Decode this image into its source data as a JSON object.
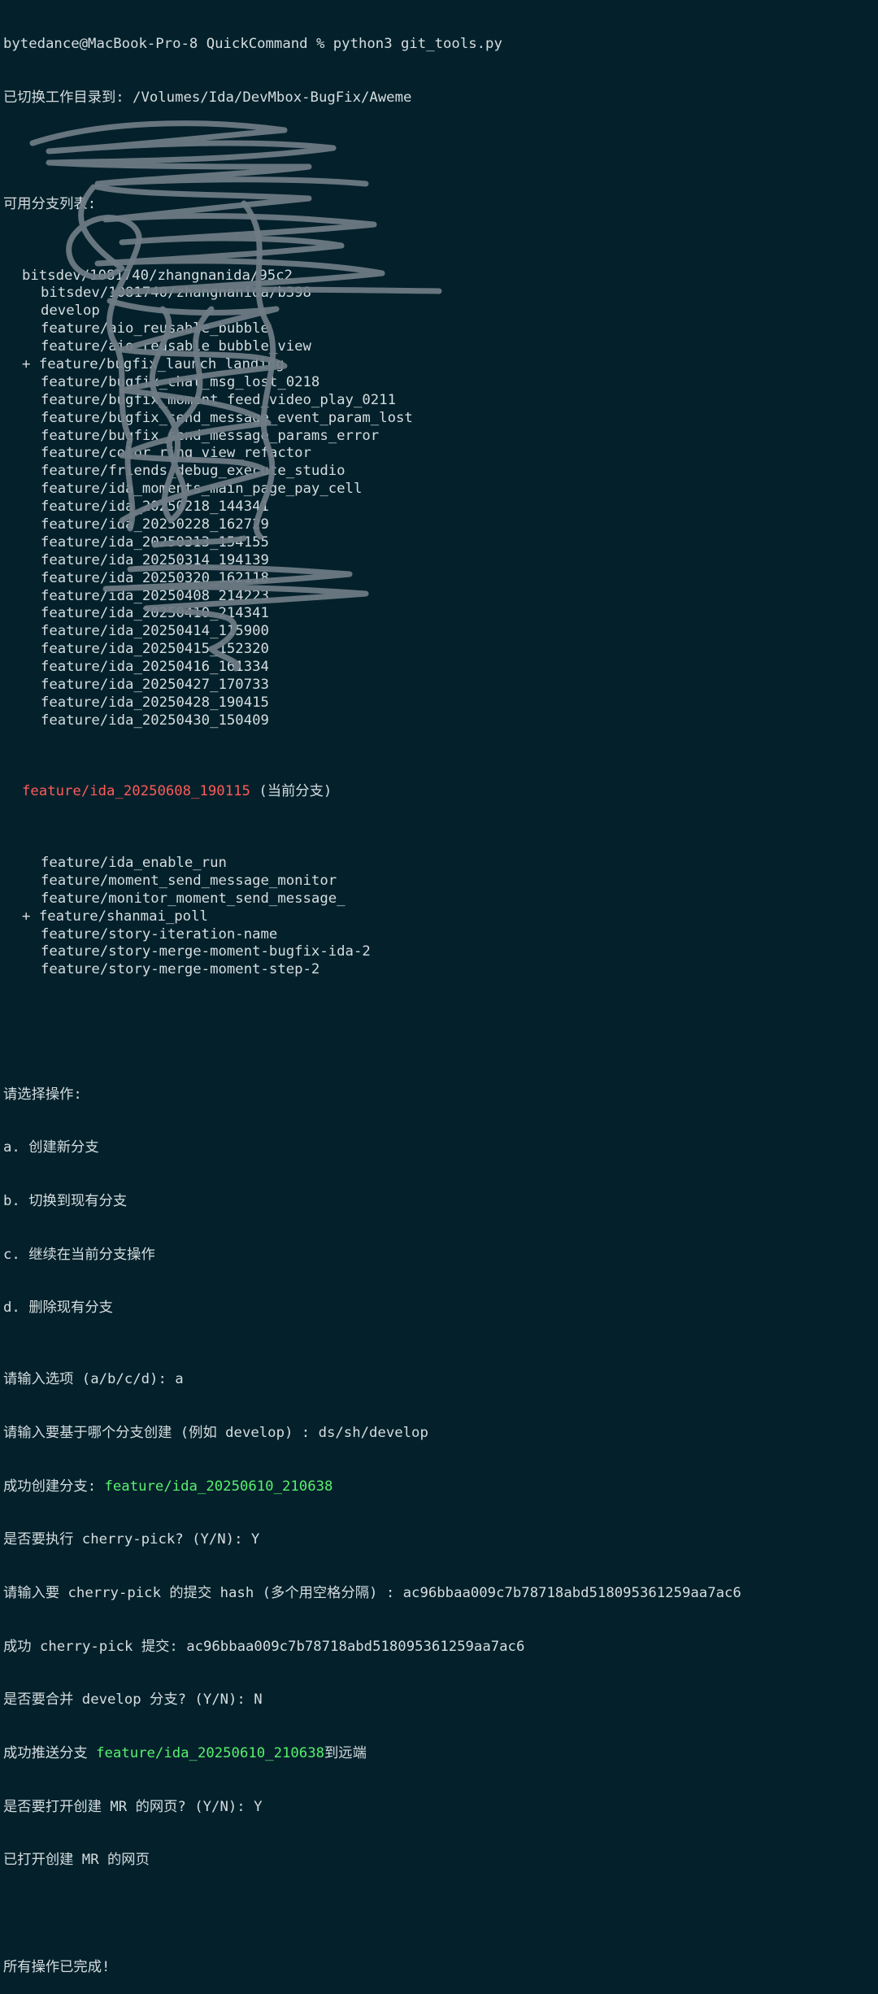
{
  "prompt": "bytedance@MacBook-Pro-8 QuickCommand % python3 git_tools.py",
  "cwd_line": "已切换工作目录到: /Volumes/Ida/DevMbox-BugFix/Aweme",
  "branch_list_title": "可用分支列表:",
  "branches": [
    {
      "prefix": "",
      "name": "bitsdev/1081740/zhangnanida/95c2",
      "indent": 1
    },
    {
      "prefix": "",
      "name": "bitsdev/1081740/zhangnanida/b398",
      "indent": 2
    },
    {
      "prefix": "",
      "name": "develop",
      "indent": 2
    },
    {
      "prefix": "",
      "name": "feature/aio_reusable_bubble",
      "indent": 2
    },
    {
      "prefix": "",
      "name": "feature/aio_reusable_bubble_view",
      "indent": 2
    },
    {
      "prefix": "+ ",
      "name": "feature/bugfix_launch_landing",
      "indent": 1
    },
    {
      "prefix": "",
      "name": "feature/bugfix_chat_msg_lost_0218",
      "indent": 2
    },
    {
      "prefix": "",
      "name": "feature/bugfix_moment_feed_video_play_0211",
      "indent": 2
    },
    {
      "prefix": "",
      "name": "feature/bugfix_send_message_event_param_lost",
      "indent": 2
    },
    {
      "prefix": "",
      "name": "feature/bugfix_send_message_params_error",
      "indent": 2
    },
    {
      "prefix": "",
      "name": "feature/color_ring_view_refactor",
      "indent": 2
    },
    {
      "prefix": "",
      "name": "feature/friends_debug_execute_studio",
      "indent": 2
    },
    {
      "prefix": "",
      "name": "feature/ida_moments_main_page_pay_cell",
      "indent": 2
    },
    {
      "prefix": "",
      "name": "feature/ida_20250218_144341",
      "indent": 2
    },
    {
      "prefix": "",
      "name": "feature/ida_20250228_162729",
      "indent": 2
    },
    {
      "prefix": "",
      "name": "feature/ida_20250313_154155",
      "indent": 2
    },
    {
      "prefix": "",
      "name": "feature/ida_20250314_194139",
      "indent": 2
    },
    {
      "prefix": "",
      "name": "feature/ida_20250320_162118",
      "indent": 2
    },
    {
      "prefix": "",
      "name": "feature/ida_20250408_214223",
      "indent": 2
    },
    {
      "prefix": "",
      "name": "feature/ida_20250410_214341",
      "indent": 2
    },
    {
      "prefix": "",
      "name": "feature/ida_20250414_115900",
      "indent": 2
    },
    {
      "prefix": "",
      "name": "feature/ida_20250415_152320",
      "indent": 2
    },
    {
      "prefix": "",
      "name": "feature/ida_20250416_161334",
      "indent": 2
    },
    {
      "prefix": "",
      "name": "feature/ida_20250427_170733",
      "indent": 2
    },
    {
      "prefix": "",
      "name": "feature/ida_20250428_190415",
      "indent": 2
    },
    {
      "prefix": "",
      "name": "feature/ida_20250430_150409",
      "indent": 2
    }
  ],
  "current_branch": {
    "name": "feature/ida_20250608_190115",
    "label": " (当前分支)"
  },
  "branches_after": [
    {
      "prefix": "",
      "name": "feature/ida_enable_run",
      "indent": 2
    },
    {
      "prefix": "",
      "name": "feature/moment_send_message_monitor",
      "indent": 2
    },
    {
      "prefix": "",
      "name": "feature/monitor_moment_send_message_",
      "indent": 2
    },
    {
      "prefix": "+ ",
      "name": "feature/shanmai_poll",
      "indent": 1
    },
    {
      "prefix": "",
      "name": "feature/story-iteration-name",
      "indent": 2
    },
    {
      "prefix": "",
      "name": "feature/story-merge-moment-bugfix-ida-2",
      "indent": 2
    },
    {
      "prefix": "",
      "name": "feature/story-merge-moment-step-2",
      "indent": 2
    }
  ],
  "menu": {
    "title": "请选择操作:",
    "options": [
      "a. 创建新分支",
      "b. 切换到现有分支",
      "c. 继续在当前分支操作",
      "d. 删除现有分支"
    ]
  },
  "session": {
    "option_prompt": "请输入选项 (a/b/c/d): a",
    "base_prompt": "请输入要基于哪个分支创建 (例如 develop) : ds/sh/develop",
    "created_label": "成功创建分支: ",
    "created_branch": "feature/ida_20250610_210638",
    "cherry_prompt": "是否要执行 cherry-pick? (Y/N): Y",
    "cherry_hash_prompt": "请输入要 cherry-pick 的提交 hash (多个用空格分隔) : ac96bbaa009c7b78718abd518095361259aa7ac6",
    "cherry_success": "成功 cherry-pick 提交: ac96bbaa009c7b78718abd518095361259aa7ac6",
    "merge_prompt": "是否要合并 develop 分支? (Y/N): N",
    "push_label": "成功推送分支 ",
    "push_branch": "feature/ida_20250610_210638",
    "push_suffix": "到远端",
    "mr_prompt": "是否要打开创建 MR 的网页? (Y/N): Y",
    "mr_opened": "已打开创建 MR 的网页",
    "done": "所有操作已完成!"
  },
  "colors": {
    "background": "#04212b",
    "text": "#d5dde0",
    "green": "#59f06e",
    "red": "#ff5a58",
    "scribble": "#6f7c85"
  }
}
